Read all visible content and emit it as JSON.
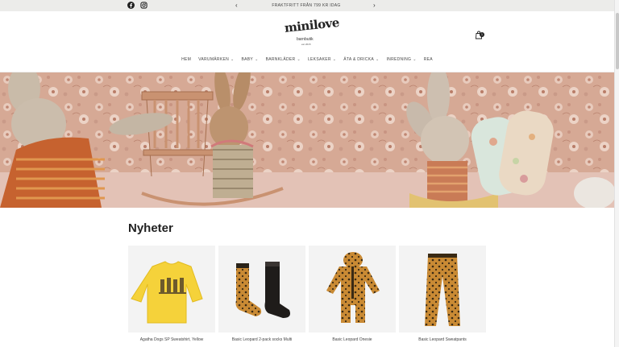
{
  "announcement": {
    "message": "FRAKTFRITT FRÅN 799 KR IDAG",
    "social": [
      "facebook-icon",
      "instagram-icon"
    ],
    "prev_icon": "‹",
    "next_icon": "›"
  },
  "header": {
    "logo": {
      "wordmark": "minilove",
      "tagline": "barnbutik",
      "since": "est 2015"
    },
    "cart_count": "1",
    "nav": [
      {
        "label": "HEM",
        "dropdown": false
      },
      {
        "label": "VARUMÄRKEN",
        "dropdown": true
      },
      {
        "label": "BABY",
        "dropdown": true
      },
      {
        "label": "BARNKLÄDER",
        "dropdown": true
      },
      {
        "label": "LEKSAKER",
        "dropdown": true
      },
      {
        "label": "ÄTA & DRICKA",
        "dropdown": true
      },
      {
        "label": "INREDNING",
        "dropdown": true
      },
      {
        "label": "REA",
        "dropdown": false
      }
    ]
  },
  "main": {
    "section_title": "Nyheter",
    "products": [
      {
        "title": "Agatha Dogs SP Sweatshirt, Yellow"
      },
      {
        "title": "Basic Leopard 2-pack socks Multi"
      },
      {
        "title": "Basic Leopard Onesie"
      },
      {
        "title": "Basic Leopard Sweatpants"
      }
    ]
  },
  "colors": {
    "announce_bg": "#ececea",
    "hero_wallpaper": "#d7ab98",
    "leopard": "#c98a34",
    "yellow": "#f5d23a"
  }
}
